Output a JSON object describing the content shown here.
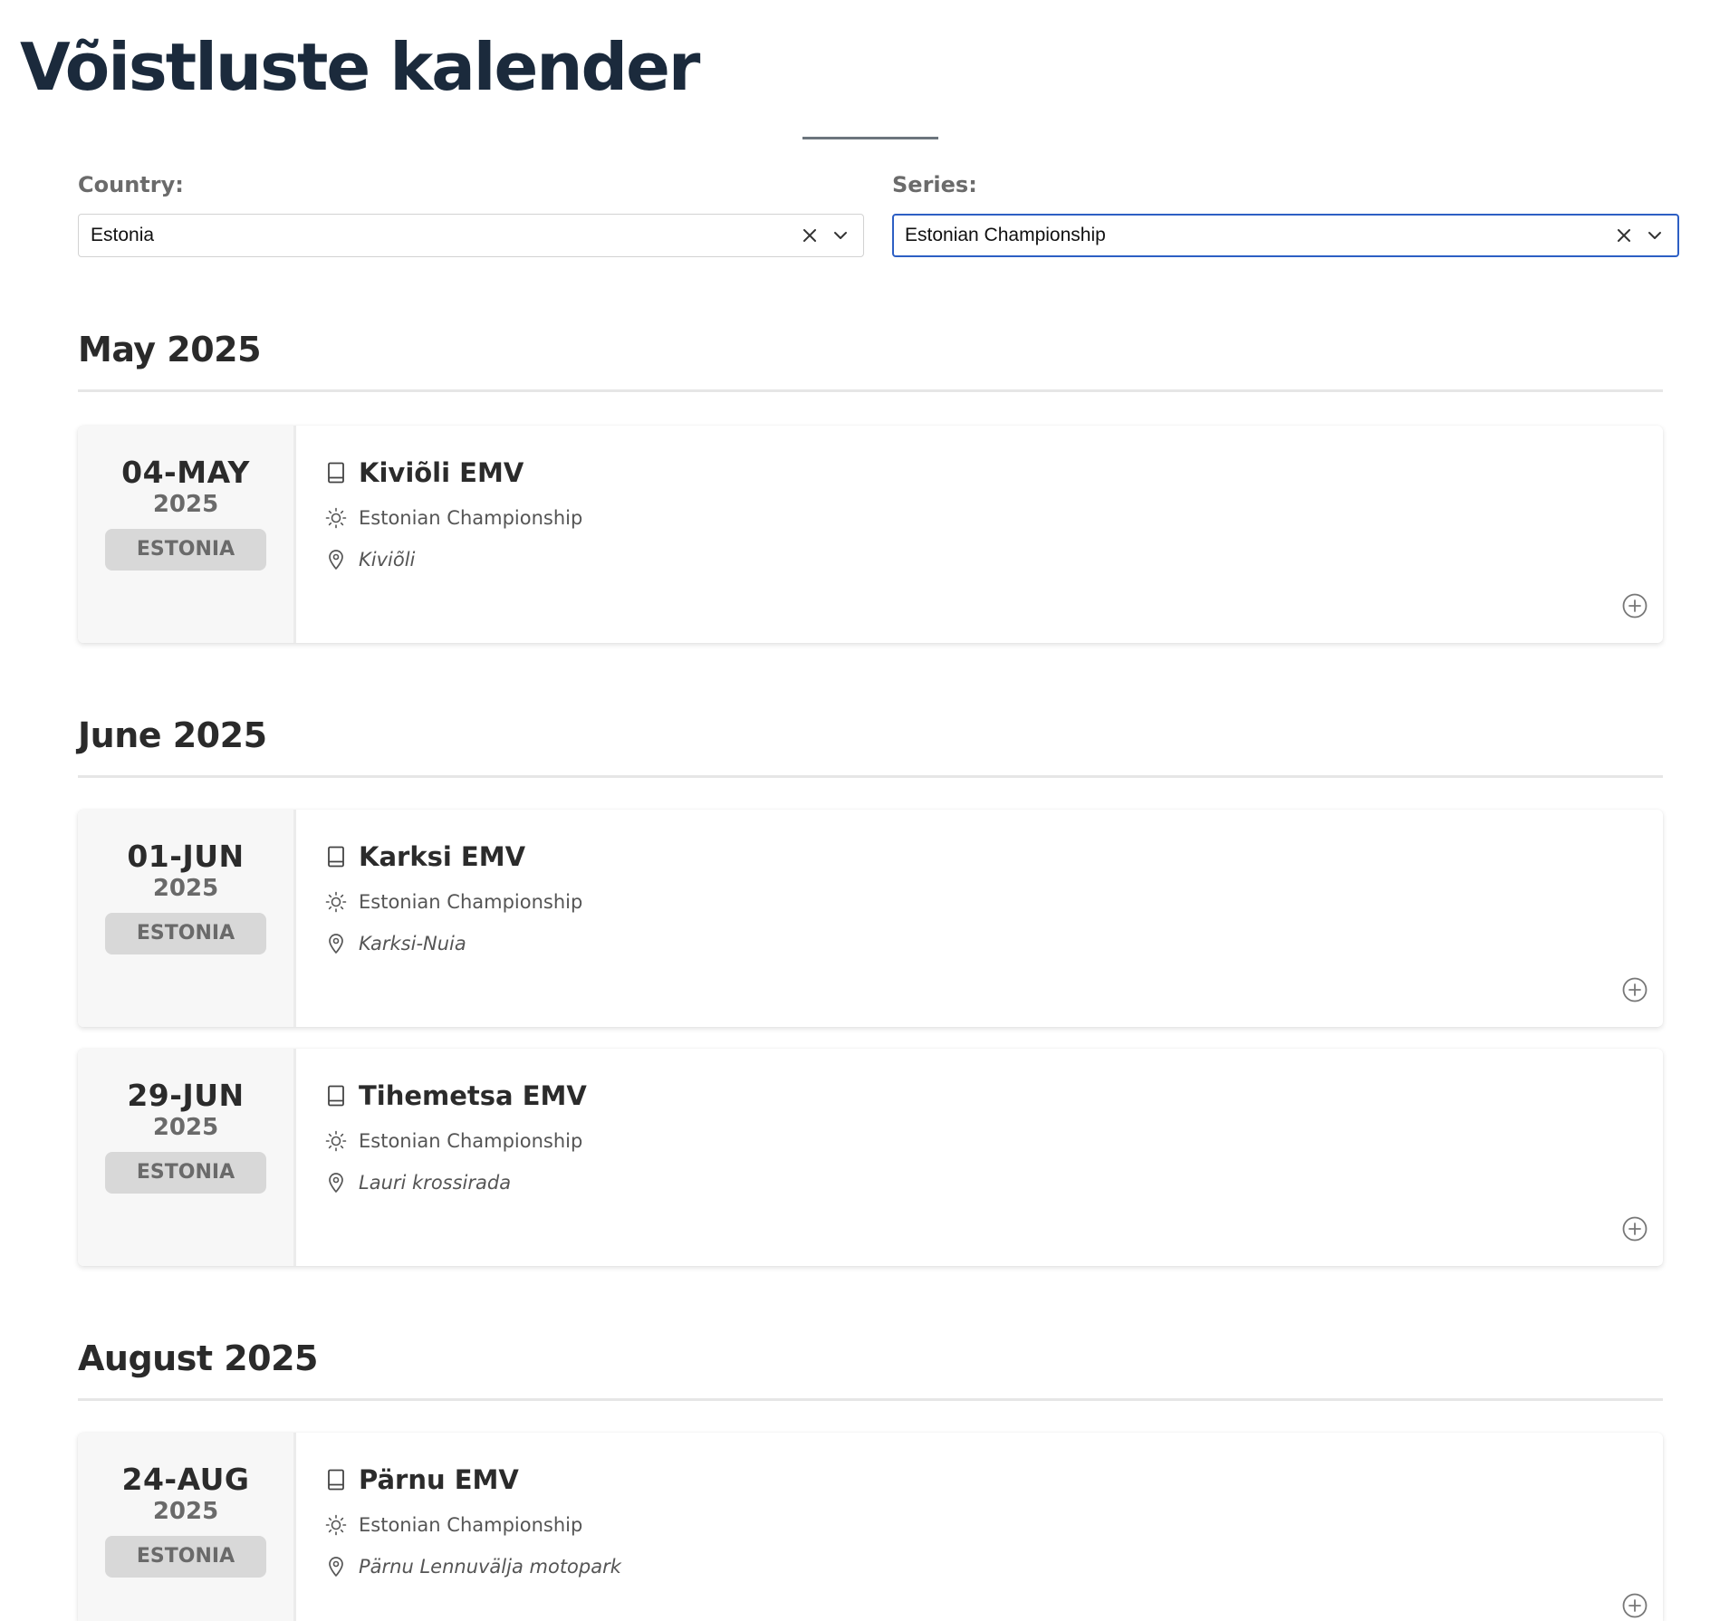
{
  "page": {
    "title": "Võistluste kalender"
  },
  "filters": {
    "country": {
      "label": "Country:",
      "value": "Estonia"
    },
    "series": {
      "label": "Series:",
      "value": "Estonian Championship"
    }
  },
  "months": [
    {
      "heading": "May 2025",
      "events": [
        {
          "day": "04-MAY",
          "year": "2025",
          "country": "ESTONIA",
          "name": "Kiviõli EMV",
          "series": "Estonian Championship",
          "location": "Kiviõli"
        }
      ]
    },
    {
      "heading": "June 2025",
      "events": [
        {
          "day": "01-JUN",
          "year": "2025",
          "country": "ESTONIA",
          "name": "Karksi EMV",
          "series": "Estonian Championship",
          "location": "Karksi-Nuia"
        },
        {
          "day": "29-JUN",
          "year": "2025",
          "country": "ESTONIA",
          "name": "Tihemetsa EMV",
          "series": "Estonian Championship",
          "location": "Lauri krossirada"
        }
      ]
    },
    {
      "heading": "August 2025",
      "events": [
        {
          "day": "24-AUG",
          "year": "2025",
          "country": "ESTONIA",
          "name": "Pärnu EMV",
          "series": "Estonian Championship",
          "location": "Pärnu Lennuvälja motopark"
        }
      ]
    }
  ],
  "icons": {
    "event": "book-icon",
    "series": "sun-icon",
    "location": "map-pin-icon",
    "add": "plus-circle-icon",
    "clear": "close-icon",
    "dropdown": "chevron-down-icon"
  },
  "colors": {
    "title": "#1b2a3c",
    "focus_border": "#2d5fc4",
    "badge_bg": "#d8d8d8"
  }
}
